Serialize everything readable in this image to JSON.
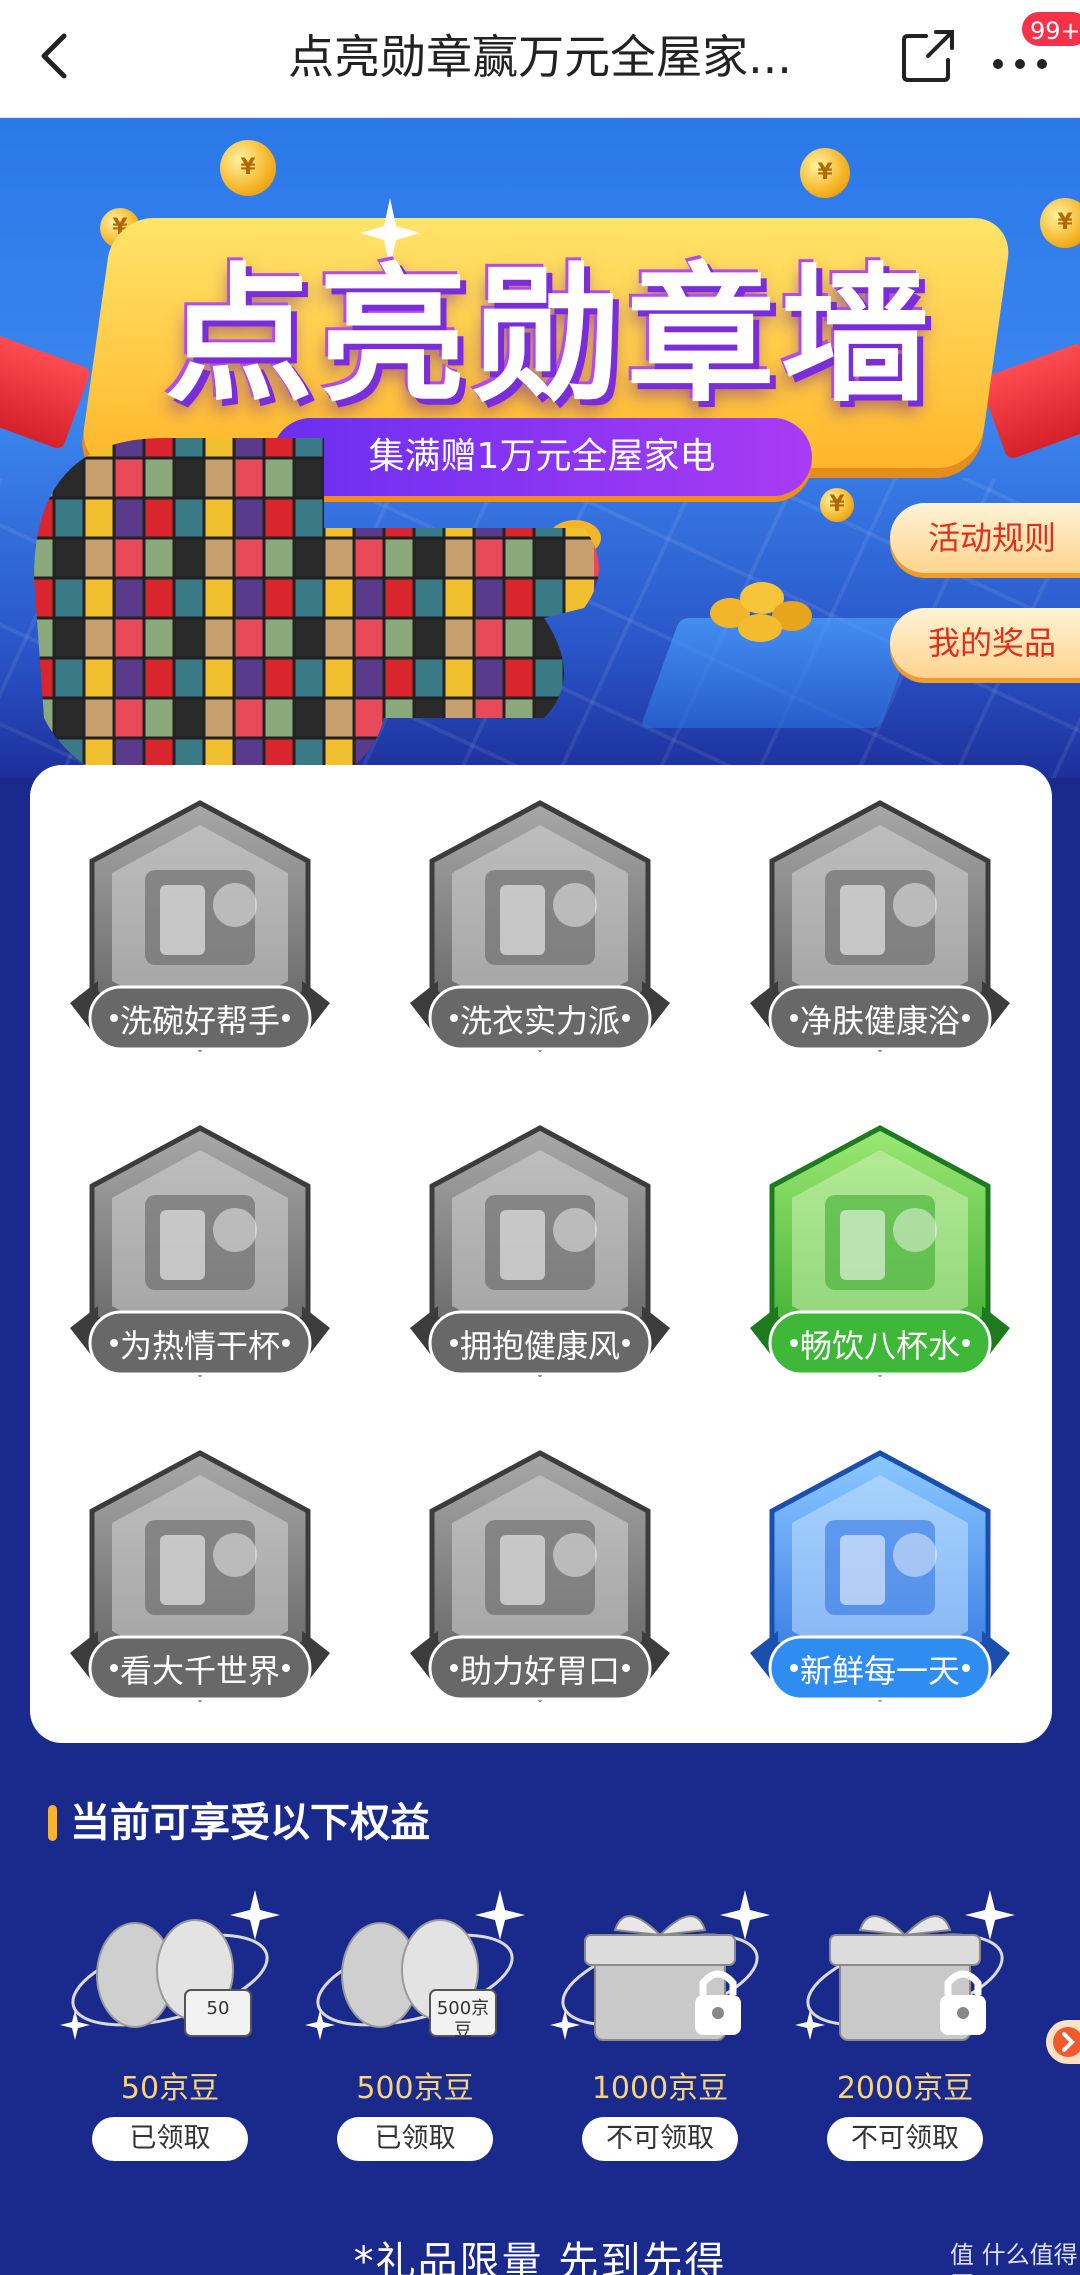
{
  "nav": {
    "title": "点亮勋章赢万元全屋家...",
    "badge_count": "99+",
    "icons": [
      "back-arrow-icon",
      "share-icon",
      "more-dots-icon"
    ]
  },
  "hero": {
    "title": "点亮勋章墙",
    "subtitle": "集满赠1万元全屋家电",
    "rules_button": "活动规则",
    "prizes_button": "我的奖品"
  },
  "badges": [
    {
      "label": "洗碗好帮手",
      "lit": false,
      "icon": "dishwasher-icon"
    },
    {
      "label": "洗衣实力派",
      "lit": false,
      "icon": "washing-machine-icon"
    },
    {
      "label": "净肤健康浴",
      "lit": false,
      "icon": "shower-icon"
    },
    {
      "label": "为热情干杯",
      "lit": false,
      "icon": "wine-cooler-icon"
    },
    {
      "label": "拥抱健康风",
      "lit": false,
      "icon": "air-conditioner-icon"
    },
    {
      "label": "畅饮八杯水",
      "lit": true,
      "color": "green",
      "icon": "water-purifier-icon"
    },
    {
      "label": "看大千世界",
      "lit": false,
      "icon": "tv-icon"
    },
    {
      "label": "助力好胃口",
      "lit": false,
      "icon": "range-hood-icon"
    },
    {
      "label": "新鲜每一天",
      "lit": true,
      "color": "blue",
      "icon": "refrigerator-icon"
    }
  ],
  "benefits": {
    "title": "当前可享受以下权益",
    "items": [
      {
        "value": "50京豆",
        "status": "已领取",
        "tag": "50",
        "locked": false
      },
      {
        "value": "500京豆",
        "status": "已领取",
        "tag": "500京豆",
        "locked": false
      },
      {
        "value": "1000京豆",
        "status": "不可领取",
        "locked": true
      },
      {
        "value": "2000京豆",
        "status": "不可领取",
        "locked": true
      }
    ]
  },
  "footer": {
    "note": "*礼品限量 先到先得",
    "watermark": "值 什么值得买"
  },
  "colors": {
    "page_bg": "#1a2a8c",
    "accent_orange": "#f7b233",
    "reward_text": "#f7d37a",
    "lit_green": "#4ec23f",
    "lit_blue": "#2f8cf0",
    "unlit_gray": "#6f6f6f"
  }
}
